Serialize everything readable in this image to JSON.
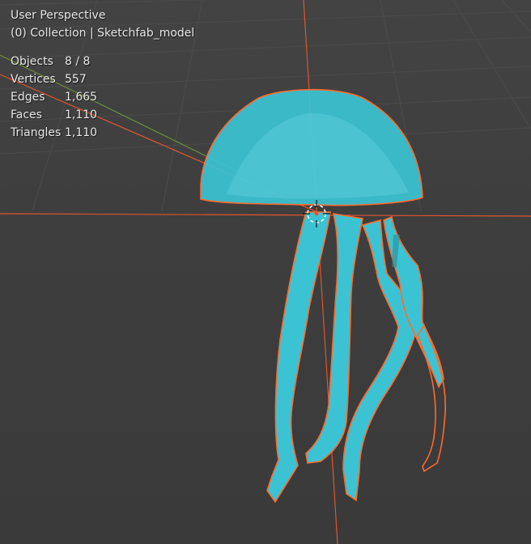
{
  "viewport": {
    "view_name": "User Perspective",
    "collection_info": "(0) Collection | Sketchfab_model",
    "stats": [
      {
        "label": "Objects",
        "value": "8 / 8"
      },
      {
        "label": "Vertices",
        "value": "557"
      },
      {
        "label": "Edges",
        "value": "1,665"
      },
      {
        "label": "Faces",
        "value": "1,110"
      },
      {
        "label": "Triangles",
        "value": "1,110"
      }
    ]
  },
  "colors": {
    "background": "#3d3d3d",
    "grid": "#4a4a4a",
    "x_axis": "#e0552e",
    "y_axis": "#6f8b3c",
    "selection_outline": "#ff6a2a",
    "mesh_fill": "#3cc3d3"
  }
}
